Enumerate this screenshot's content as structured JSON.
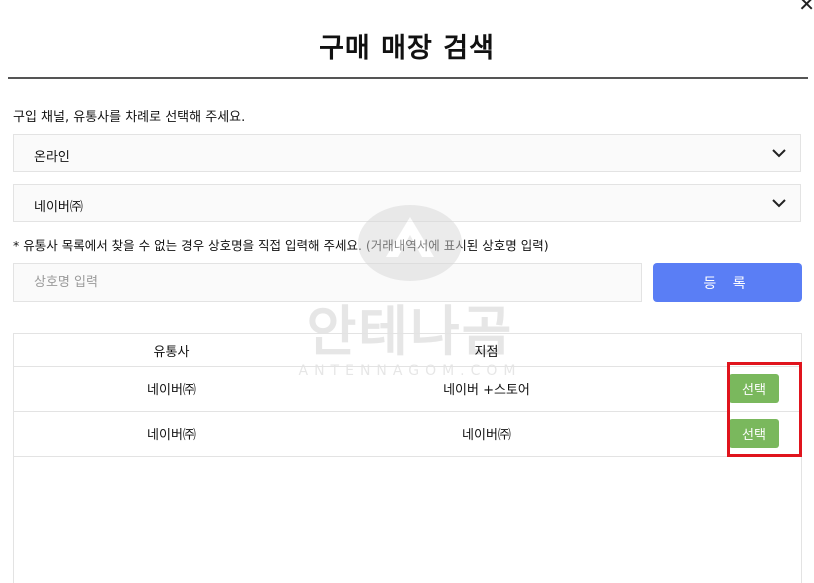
{
  "page_title": "구매 매장 검색",
  "instruction": "구입 채널, 유통사를 차례로 선택해 주세요.",
  "channel_select": {
    "value": "온라인",
    "icon": "chevron-down-icon"
  },
  "distributor_select": {
    "value": "네이버㈜",
    "icon": "chevron-down-icon"
  },
  "note": "* 유통사 목록에서 찾을 수 없는 경우 상호명을 직접 입력해 주세요. (거래내역서에 표시된 상호명 입력)",
  "name_input": {
    "placeholder": "상호명 입력",
    "value": ""
  },
  "register_button": "등 록",
  "table": {
    "headers": {
      "distributor": "유통사",
      "branch": "지점"
    },
    "rows": [
      {
        "distributor": "네이버㈜",
        "branch": "네이버 +스토어",
        "action": "선택"
      },
      {
        "distributor": "네이버㈜",
        "branch": "네이버㈜",
        "action": "선택"
      }
    ]
  },
  "watermark": {
    "logo_text": "안테나곰",
    "sub_text": "ANTENNAGOM.COM"
  },
  "colors": {
    "register_button": "#5a7ef5",
    "select_button": "#7ab85d",
    "highlight_box": "#e0141d"
  }
}
